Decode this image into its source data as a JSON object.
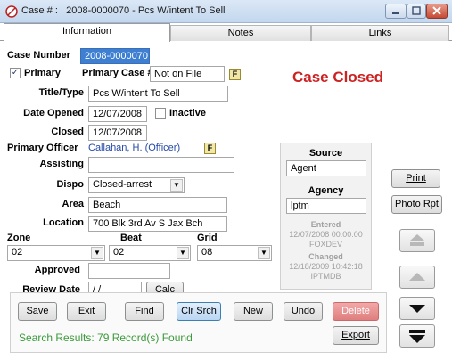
{
  "window": {
    "title": "Case # :   2008-0000070 - Pcs W/intent To Sell"
  },
  "tabs": [
    "Information",
    "Notes",
    "Links"
  ],
  "form": {
    "case_number_label": "Case Number",
    "case_number": "2008-0000070",
    "primary_label": "Primary",
    "primary_checked": true,
    "primary_case_label": "Primary Case #",
    "primary_case_value": "Not on File",
    "title_type_label": "Title/Type",
    "title_type_value": "Pcs W/intent To Sell",
    "date_opened_label": "Date Opened",
    "date_opened": "12/07/2008",
    "inactive_label": "Inactive",
    "inactive_checked": false,
    "closed_label": "Closed",
    "closed_date": "12/07/2008",
    "primary_officer_label": "Primary Officer",
    "primary_officer_value": "Callahan, H. (Officer)",
    "assisting_label": "Assisting",
    "assisting_value": "",
    "dispo_label": "Dispo",
    "dispo_value": "Closed-arrest",
    "area_label": "Area",
    "area_value": "Beach",
    "location_label": "Location",
    "location_value": "700 Blk 3rd Av S Jax Bch",
    "zone_label": "Zone",
    "zone_value": "02",
    "beat_label": "Beat",
    "beat_value": "02",
    "grid_label": "Grid",
    "grid_value": "08",
    "approved_label": "Approved",
    "approved_value": "",
    "review_date_label": "Review Date",
    "review_date_value": "/ /",
    "calc_label": "Calc",
    "f_label": "F"
  },
  "status": {
    "text": "Case Closed",
    "color": "#cc2222"
  },
  "info_panel": {
    "source_label": "Source",
    "source_value": "Agent",
    "agency_label": "Agency",
    "agency_value": "lptm",
    "entered_label": "Entered",
    "entered_date": "12/07/2008 00:00:00",
    "entered_by": "FOXDEV",
    "changed_label": "Changed",
    "changed_date": "12/18/2009 10:42:18",
    "changed_by": "IPTMDB"
  },
  "side_buttons": {
    "print": "Print",
    "photo_rpt": "Photo Rpt"
  },
  "bottom_buttons": {
    "save": "Save",
    "exit": "Exit",
    "find": "Find",
    "clr_srch": "Clr Srch",
    "new": "New",
    "undo": "Undo",
    "delete": "Delete",
    "export": "Export"
  },
  "search_results": "Search Results: 79 Record(s) Found",
  "icons": [
    "case-icon",
    "minimize-icon",
    "maximize-icon",
    "close-icon",
    "dropdown-arrow-icon",
    "first-record-icon",
    "prev-record-icon",
    "next-record-icon",
    "last-record-icon"
  ]
}
